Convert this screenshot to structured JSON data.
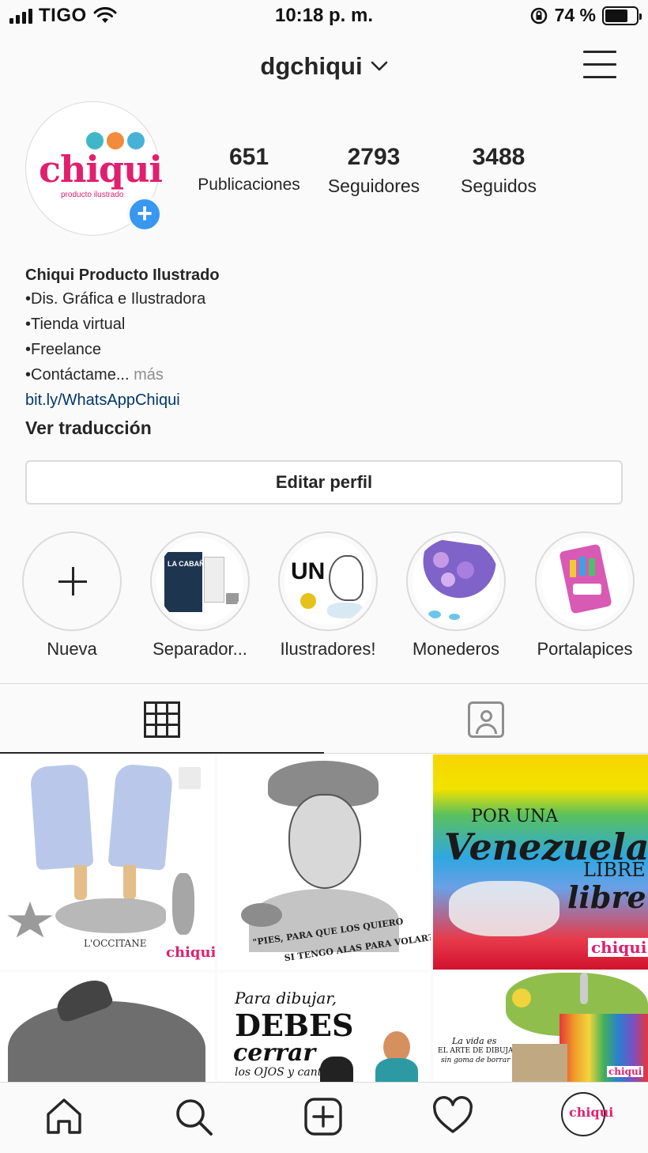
{
  "status_bar": {
    "carrier": "TIGO",
    "time": "10:18 p. m.",
    "battery_percent": "74 %",
    "battery_level": 0.74
  },
  "header": {
    "username": "dgchiqui"
  },
  "avatar": {
    "logo_text": "chiqui",
    "logo_subtitle": "producto ilustrado"
  },
  "stats": {
    "posts": {
      "value": "651",
      "label": "Publicaciones"
    },
    "followers": {
      "value": "2793",
      "label": "Seguidores"
    },
    "following": {
      "value": "3488",
      "label": "Seguidos"
    }
  },
  "bio": {
    "name": "Chiqui Producto Ilustrado",
    "lines": [
      "•Dis. Gráfica e Ilustradora",
      "•Tienda virtual",
      "•Freelance",
      "•Contáctame..."
    ],
    "more": "más",
    "link": "bit.ly/WhatsAppChiqui",
    "translate": "Ver traducción"
  },
  "edit_profile_label": "Editar perfil",
  "highlights": [
    {
      "label": "Nueva"
    },
    {
      "label": "Separador..."
    },
    {
      "label": "Ilustradores!"
    },
    {
      "label": "Monederos"
    },
    {
      "label": "Portalapices"
    }
  ],
  "highlight_art": {
    "book_title": "LA CABAÑA",
    "poster_word": "UN"
  },
  "posts": {
    "post1_caption": "L'OCCITANE",
    "post1_logo": "chiqui",
    "post2_quote_1": "\"PIES, PARA QUE LOS QUIERO",
    "post2_quote_2": "SI TENGO ALAS PARA VOLAR?",
    "post3_line1": "POR UNA",
    "post3_line2": "Venezuela",
    "post3_line3": "LIBRE",
    "post3_line4": "libre",
    "post3_logo": "chiqui",
    "post5_line1": "Para dibujar,",
    "post5_line2": "DEBES",
    "post5_line3": "cerrar",
    "post5_line4": "los OJOS y cantar",
    "post6_line1": "La vida es",
    "post6_line2": "EL ARTE DE DIBUJAR",
    "post6_line3": "sin goma de borrar",
    "post6_logo": "chiqui"
  },
  "nav": {
    "profile_logo": "chiqui"
  },
  "colors": {
    "brand_pink": "#e0206e",
    "link_blue": "#00376b",
    "add_blue": "#3897f0"
  }
}
